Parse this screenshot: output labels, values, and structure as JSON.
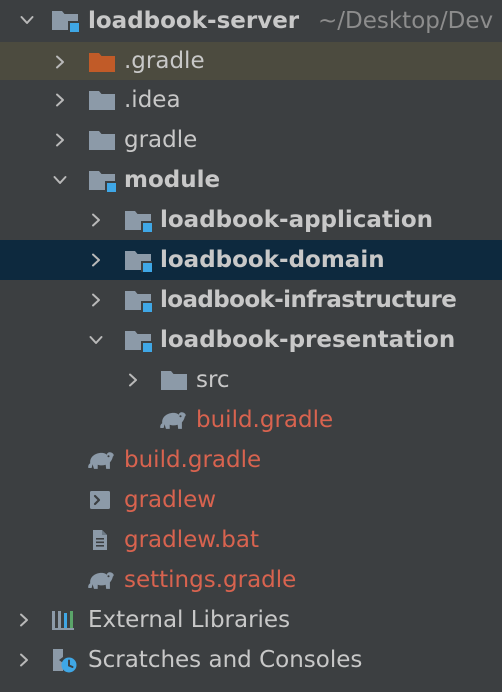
{
  "root": {
    "name": "loadbook-server",
    "path": "~/Desktop/Dev"
  },
  "items": [
    {
      "label": ".gradle"
    },
    {
      "label": ".idea"
    },
    {
      "label": "gradle"
    },
    {
      "label": "module"
    },
    {
      "label": "loadbook-application"
    },
    {
      "label": "loadbook-domain"
    },
    {
      "label": "loadbook-infrastructure"
    },
    {
      "label": "loadbook-presentation"
    },
    {
      "label": "src"
    },
    {
      "label": "build.gradle"
    },
    {
      "label": "build.gradle"
    },
    {
      "label": "gradlew"
    },
    {
      "label": "gradlew.bat"
    },
    {
      "label": "settings.gradle"
    },
    {
      "label": "External Libraries"
    },
    {
      "label": "Scratches and Consoles"
    }
  ],
  "colors": {
    "background": "#3c3f41",
    "selected_row": "#0d293e",
    "excluded_folder_row": "#4c4b3f",
    "text": "#c8c8c8",
    "untracked_file_text": "#d8634f",
    "folder": "#8c9aa8",
    "module_badge": "#3fa7e6",
    "excluded_folder": "#c15b28"
  },
  "icons": {
    "expanded": "chevron-down-icon",
    "collapsed": "chevron-right-icon",
    "folder": "folder-icon",
    "module_folder": "module-folder-icon",
    "excluded_folder": "excluded-folder-icon",
    "gradle_file": "gradle-elephant-icon",
    "shell_script": "terminal-file-icon",
    "text_file": "text-file-icon",
    "libraries": "libraries-icon",
    "scratches": "scratches-icon"
  }
}
